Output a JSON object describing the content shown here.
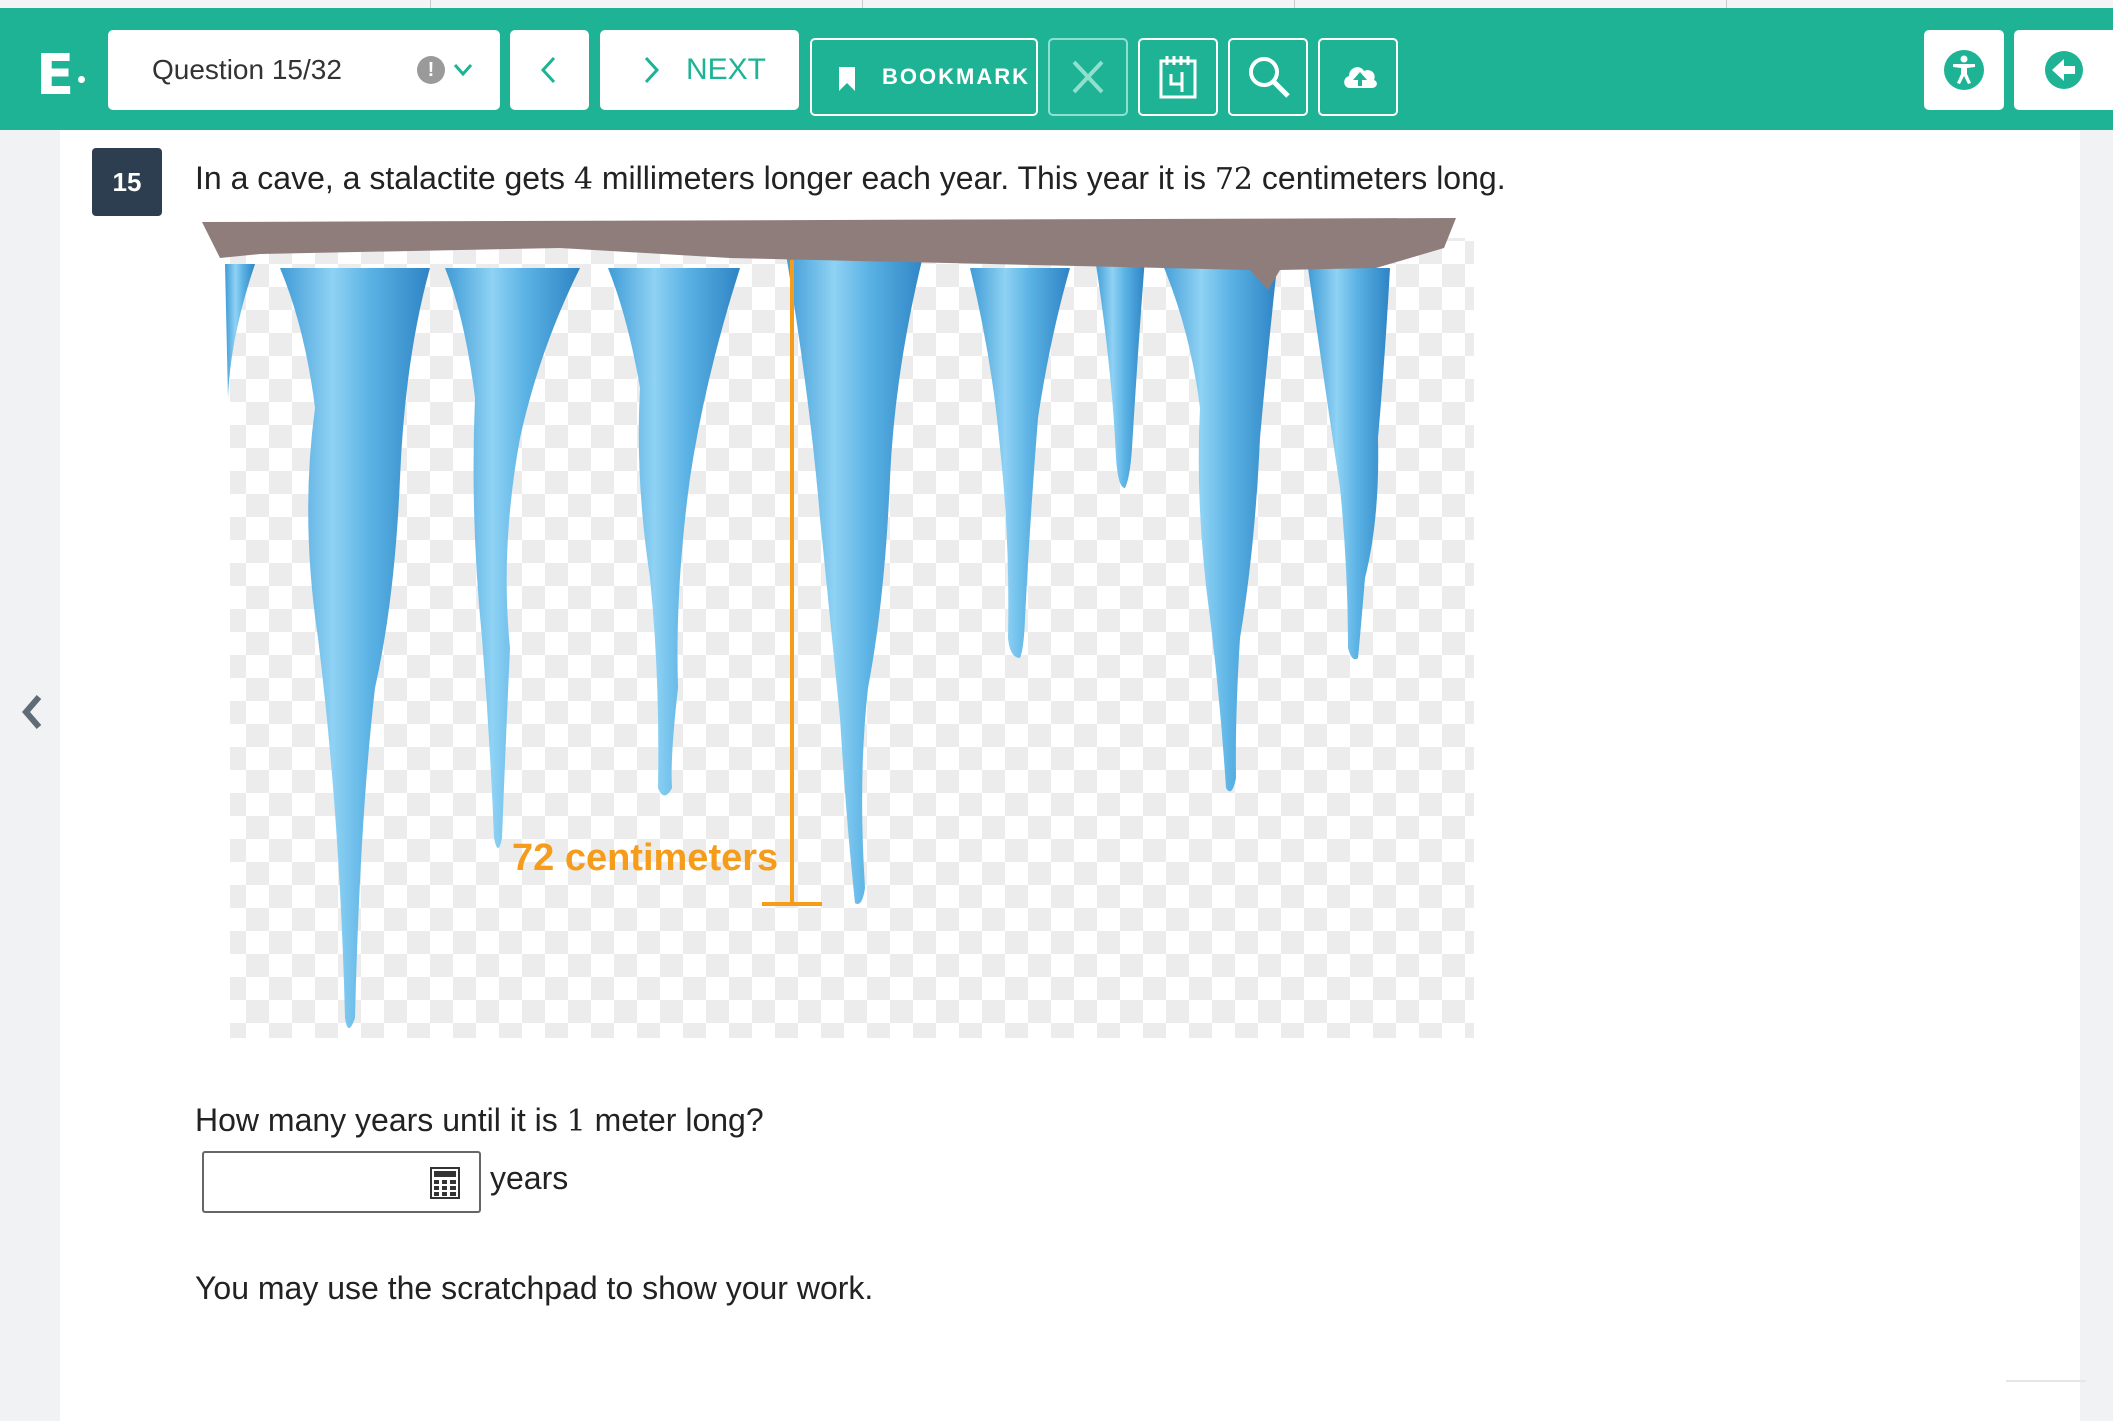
{
  "toolbar": {
    "logo": "E",
    "question_selector": "Question 15/32",
    "alert_symbol": "!",
    "next_label": "NEXT",
    "bookmark_label": "BOOKMARK"
  },
  "question": {
    "number": "15",
    "intro_a": "In a cave, a stalactite gets",
    "growth_value": "4",
    "intro_b": "millimeters longer each year. This year it is",
    "length_value": "72",
    "intro_c": "centimeters long.",
    "figure_label": "72 centimeters",
    "prompt_a": "How many years until it is",
    "target_value": "1",
    "prompt_b": "meter long?",
    "answer_value": "",
    "units": "years",
    "note": "You may use the scratchpad to show your work."
  },
  "colors": {
    "toolbar": "#1db394",
    "question_badge": "#2c3e50",
    "rock": "#8f7d7b",
    "ice": "#5ab2e4",
    "measure": "#f59c1a"
  }
}
